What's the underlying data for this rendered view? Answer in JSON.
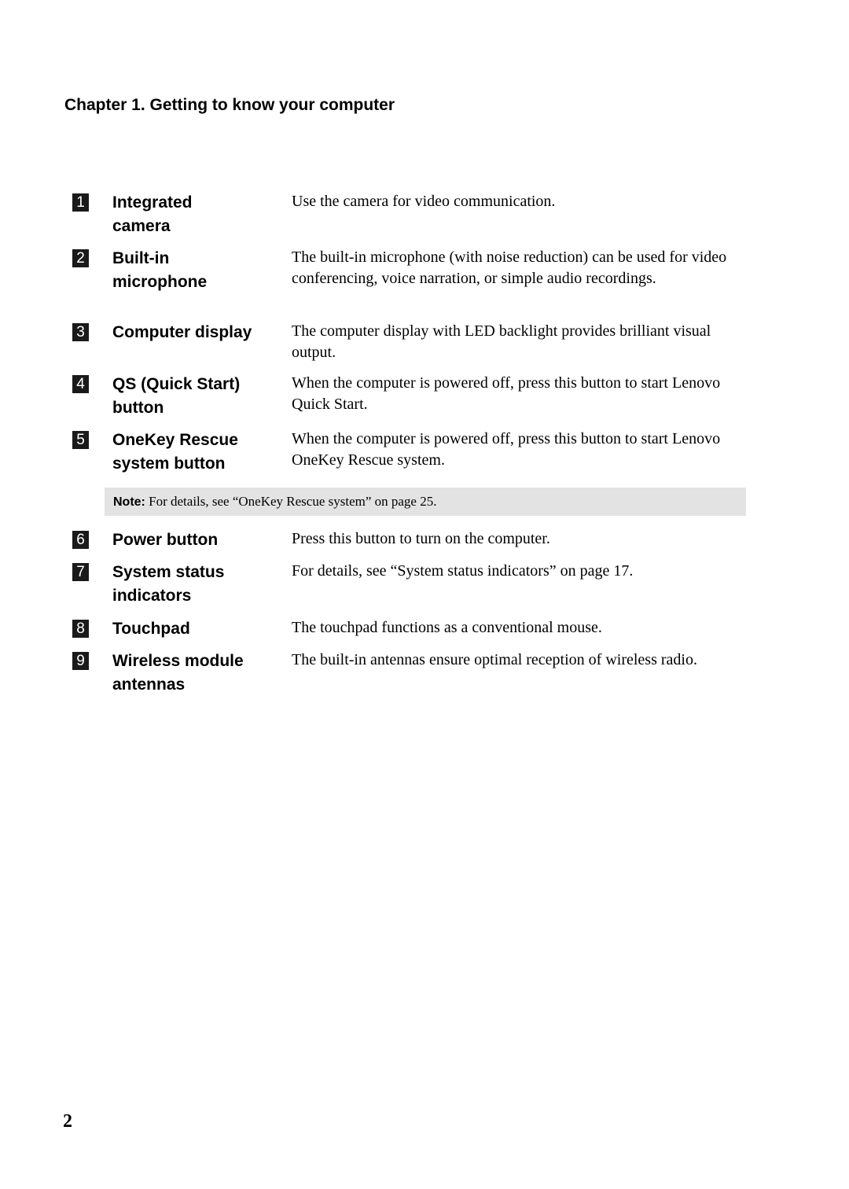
{
  "chapter_title": "Chapter 1. Getting to know your computer",
  "items": [
    {
      "number": "1",
      "term": "Integrated camera",
      "description": "Use the camera for video communication."
    },
    {
      "number": "2",
      "term": "Built-in microphone",
      "description": "The built-in microphone (with noise reduction) can be used for video conferencing, voice narration, or simple audio recordings."
    },
    {
      "number": "3",
      "term": "Computer display",
      "description": "The computer display with LED backlight provides brilliant visual output."
    },
    {
      "number": "4",
      "term": "QS (Quick Start) button",
      "description": "When the computer is powered off, press this button to start Lenovo Quick Start."
    },
    {
      "number": "5",
      "term": "OneKey Rescue system button",
      "description": "When the computer is powered off, press this button to start Lenovo OneKey Rescue system."
    },
    {
      "number": "6",
      "term": "Power button",
      "description": "Press this button to turn on the computer."
    },
    {
      "number": "7",
      "term": "System status indicators",
      "description": "For details, see “System status indicators” on page 17."
    },
    {
      "number": "8",
      "term": "Touchpad",
      "description": "The touchpad functions as a conventional mouse."
    },
    {
      "number": "9",
      "term": "Wireless module antennas",
      "description": "The built-in antennas ensure optimal reception of wireless radio."
    }
  ],
  "note": {
    "label": "Note:",
    "text": " For details, see “OneKey Rescue system” on page 25."
  },
  "page_number": "2"
}
